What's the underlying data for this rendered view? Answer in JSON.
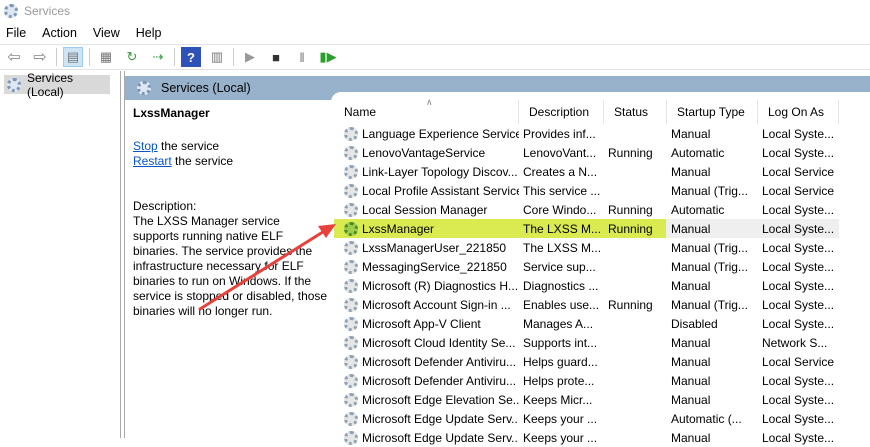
{
  "window": {
    "title": "Services"
  },
  "menu": [
    "File",
    "Action",
    "View",
    "Help"
  ],
  "toolbar": [
    "back",
    "forward",
    "show-hide-console-tree",
    "properties",
    "refresh",
    "export-list",
    "help",
    "show-action-pane",
    "start",
    "stop",
    "pause",
    "resume"
  ],
  "tree": {
    "item": "Services (Local)"
  },
  "banner": {
    "title": "Services (Local)"
  },
  "detail": {
    "name": "LxssManager",
    "stop_link": "Stop",
    "stop_rest": " the service",
    "restart_link": "Restart",
    "restart_rest": " the service",
    "desc_label": "Description:",
    "description": "The LXSS Manager service supports running native ELF binaries. The service provides the infrastructure necessary for ELF binaries to run on Windows. If the service is stopped or disabled, those binaries will no longer run."
  },
  "columns": [
    "Name",
    "Description",
    "Status",
    "Startup Type",
    "Log On As"
  ],
  "rows": [
    [
      "Language Experience Service",
      "Provides inf...",
      "",
      "Manual",
      "Local Syste..."
    ],
    [
      "LenovoVantageService",
      "LenovoVant...",
      "Running",
      "Automatic",
      "Local Syste..."
    ],
    [
      "Link-Layer Topology Discov...",
      "Creates a N...",
      "",
      "Manual",
      "Local Service"
    ],
    [
      "Local Profile Assistant Service",
      "This service ...",
      "",
      "Manual (Trig...",
      "Local Service"
    ],
    [
      "Local Session Manager",
      "Core Windo...",
      "Running",
      "Automatic",
      "Local Syste..."
    ],
    [
      "LxssManager",
      "The LXSS M...",
      "Running",
      "Manual",
      "Local Syste..."
    ],
    [
      "LxssManagerUser_221850",
      "The LXSS M...",
      "",
      "Manual (Trig...",
      "Local Syste..."
    ],
    [
      "MessagingService_221850",
      "Service sup...",
      "",
      "Manual (Trig...",
      "Local Syste..."
    ],
    [
      "Microsoft (R) Diagnostics H...",
      "Diagnostics ...",
      "",
      "Manual",
      "Local Syste..."
    ],
    [
      "Microsoft Account Sign-in ...",
      "Enables use...",
      "Running",
      "Manual (Trig...",
      "Local Syste..."
    ],
    [
      "Microsoft App-V Client",
      "Manages A...",
      "",
      "Disabled",
      "Local Syste..."
    ],
    [
      "Microsoft Cloud Identity Se...",
      "Supports int...",
      "",
      "Manual",
      "Network S..."
    ],
    [
      "Microsoft Defender Antiviru...",
      "Helps guard...",
      "",
      "Manual",
      "Local Service"
    ],
    [
      "Microsoft Defender Antiviru...",
      "Helps prote...",
      "",
      "Manual",
      "Local Syste..."
    ],
    [
      "Microsoft Edge Elevation Se...",
      "Keeps Micr...",
      "",
      "Manual",
      "Local Syste..."
    ],
    [
      "Microsoft Edge Update Serv...",
      "Keeps your ...",
      "",
      "Automatic (...",
      "Local Syste..."
    ],
    [
      "Microsoft Edge Update Serv...",
      "Keeps your ...",
      "",
      "Manual",
      "Local Syste..."
    ]
  ],
  "highlight_index": 5,
  "colors": {
    "highlight": "#d9eb50",
    "banner": "#98b2cc",
    "arrow": "#e8413c",
    "link": "#0a55c6"
  }
}
